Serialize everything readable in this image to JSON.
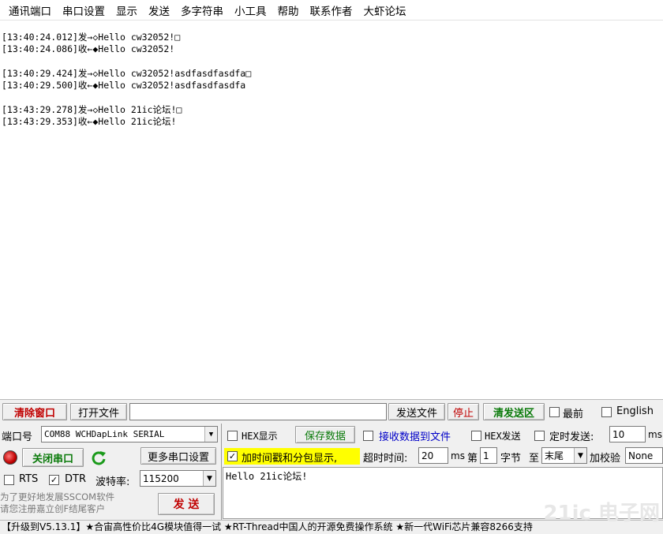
{
  "menu": [
    "通讯端口",
    "串口设置",
    "显示",
    "发送",
    "多字符串",
    "小工具",
    "帮助",
    "联系作者",
    "大虾论坛"
  ],
  "log": [
    "[13:40:24.012]发→◇Hello cw32052!□",
    "[13:40:24.086]收←◆Hello cw32052!",
    "",
    "[13:40:29.424]发→◇Hello cw32052!asdfasdfasdfa□",
    "[13:40:29.500]收←◆Hello cw32052!asdfasdfasdfa",
    "",
    "[13:43:29.278]发→◇Hello 21ic论坛!□",
    "[13:43:29.353]收←◆Hello 21ic论坛!"
  ],
  "toolbar": {
    "clear_window": "清除窗口",
    "open_file": "打开文件",
    "file_path": "",
    "send_file": "发送文件",
    "stop": "停止",
    "clear_send": "清发送区",
    "topmost": "最前",
    "english": "English"
  },
  "port": {
    "label": "端口号",
    "value": "COM88 WCHDapLink SERIAL",
    "close_button": "关闭串口",
    "more_settings": "更多串口设置",
    "rts": "RTS",
    "dtr": "DTR",
    "baud_label": "波特率:",
    "baud_value": "115200",
    "promo_line1": "为了更好地发展SSCOM软件",
    "promo_line2": "请您注册嘉立创F结尾客户",
    "send_button": "发 送"
  },
  "options": {
    "hex_display": "HEX显示",
    "save_data": "保存数据",
    "recv_to_file": "接收数据到文件",
    "hex_send": "HEX发送",
    "timed_send": "定时发送:",
    "timed_value": "10",
    "timed_unit": "ms",
    "add_timestamp": "加时间戳和分包显示,",
    "timeout_label": "超时时间:",
    "timeout_value": "20",
    "timeout_unit": "ms",
    "nth_label": "第",
    "nth_value": "1",
    "byte_label": "字节",
    "to_label": "至",
    "to_value": "末尾",
    "checksum_label": "加校验",
    "checksum_value": "None"
  },
  "send_text": "Hello 21ic论坛!",
  "ticker": "【升级到V5.13.1】★合宙高性价比4G模块值得一试 ★RT-Thread中国人的开源免费操作系统 ★新一代WiFi芯片兼容8266支持",
  "watermark": "21ic 电子网",
  "colors": {
    "accent_red": "#c00000",
    "accent_green": "#0a7a0a",
    "highlight_yellow": "#ffff00",
    "link_blue": "#0000c8"
  }
}
